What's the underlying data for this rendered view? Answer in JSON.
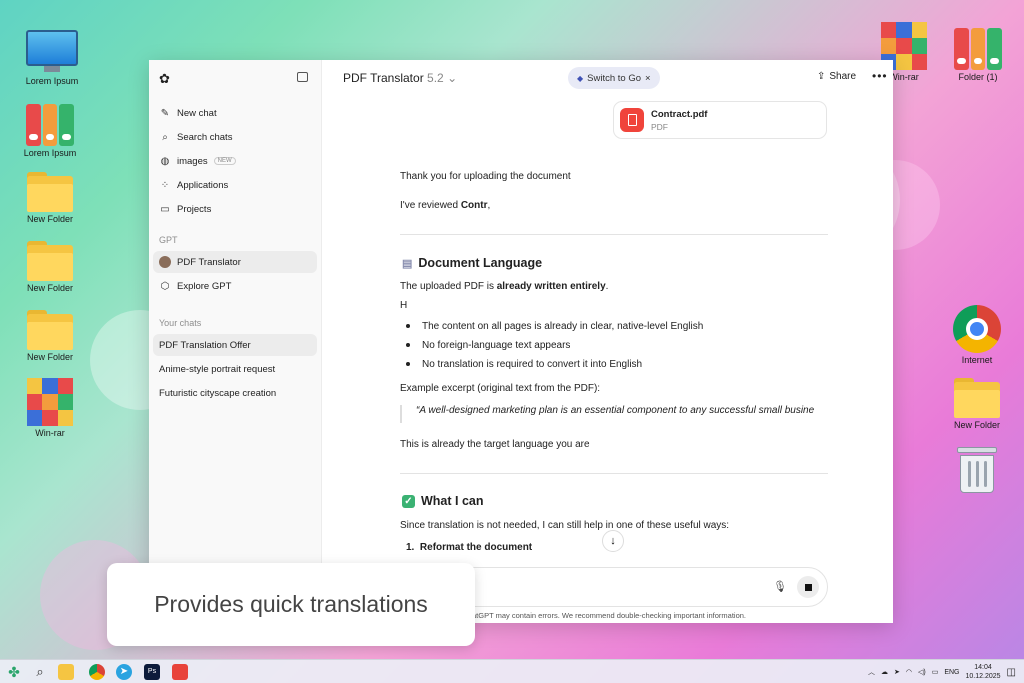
{
  "desktop": {
    "left_icons": [
      {
        "label": "Lorem Ipsum",
        "kind": "monitor"
      },
      {
        "label": "Lorem Ipsum",
        "kind": "binders"
      },
      {
        "label": "New Folder",
        "kind": "folder"
      },
      {
        "label": "New Folder",
        "kind": "folder"
      },
      {
        "label": "New Folder",
        "kind": "folder"
      },
      {
        "label": "Win-rar",
        "kind": "winrar"
      }
    ],
    "right_icons": [
      {
        "label": "Win-rar",
        "kind": "winrar"
      },
      {
        "label": "Folder (1)",
        "kind": "binders"
      },
      {
        "label": "Internet",
        "kind": "chrome"
      },
      {
        "label": "New Folder",
        "kind": "folder"
      },
      {
        "label": "",
        "kind": "recycle-bin"
      }
    ]
  },
  "sidebar": {
    "items": [
      {
        "label": "New chat",
        "icon": "edit-icon"
      },
      {
        "label": "Search chats",
        "icon": "search-icon"
      },
      {
        "label": "images",
        "icon": "image-icon",
        "badge": "NEW"
      },
      {
        "label": "Applications",
        "icon": "grid-icon"
      },
      {
        "label": "Projects",
        "icon": "folder-icon"
      }
    ],
    "gpt_section": "GPT",
    "gpts": [
      {
        "label": "PDF Translator",
        "selected": true
      },
      {
        "label": "Explore GPT"
      }
    ],
    "chats_section": "Your chats",
    "chats": [
      {
        "label": "PDF Translation Offer",
        "selected": true
      },
      {
        "label": "Anime-style portrait request"
      },
      {
        "label": "Futuristic cityscape creation"
      }
    ]
  },
  "header": {
    "title": "PDF Translator",
    "version": "5.2",
    "switch_label": "Switch to Go",
    "share_label": "Share"
  },
  "attachment": {
    "name": "Contract.pdf",
    "type": "PDF"
  },
  "message": {
    "p1": "Thank you for uploading the document",
    "p2_prefix": "I've reviewed ",
    "p2_bold": "Contr",
    "p2_suffix": ",",
    "section1_title": "Document Language",
    "s1_prefix": "The uploaded PDF is ",
    "s1_bold": "already written entirely",
    "s1_suffix": ".",
    "stray": "H",
    "bullets": [
      "The content on all pages is already in clear, native-level English",
      "No foreign-language text appears",
      "No translation is required to convert it into English"
    ],
    "example_label": "Example excerpt (original text from the PDF):",
    "quote": "“A well-designed marketing plan is an essential component to any successful small busine",
    "target_line": "This is already the target language you are",
    "section2_title": "What I can",
    "s2_line": "Since translation is not needed, I can still help in one of these useful ways:",
    "list_num": "1.",
    "list_item": "Reformat the document"
  },
  "disclaimer": "atGPT may contain errors. We recommend double-checking important information.",
  "overlay_card": "Provides quick translations",
  "taskbar": {
    "lang": "ENG",
    "time": "14:04",
    "date": "10.12.2025"
  }
}
